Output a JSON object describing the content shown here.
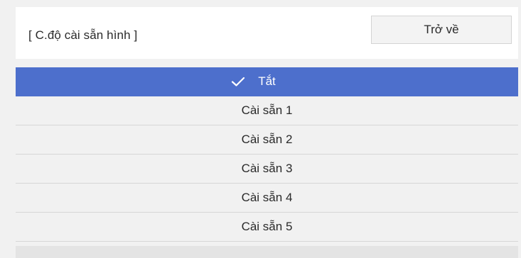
{
  "header": {
    "title": "[ C.độ cài sẵn hình ]",
    "back_label": "Trở về"
  },
  "list": {
    "items": [
      {
        "label": "Tắt",
        "selected": true
      },
      {
        "label": "Cài sẵn 1",
        "selected": false
      },
      {
        "label": "Cài sẵn 2",
        "selected": false
      },
      {
        "label": "Cài sẵn 3",
        "selected": false
      },
      {
        "label": "Cài sẵn 4",
        "selected": false
      },
      {
        "label": "Cài sẵn 5",
        "selected": false
      }
    ]
  },
  "colors": {
    "selected_bg": "#4d6fcc",
    "panel_bg": "#f1f1f1"
  },
  "icons": {
    "selected_marker": "check-icon"
  }
}
